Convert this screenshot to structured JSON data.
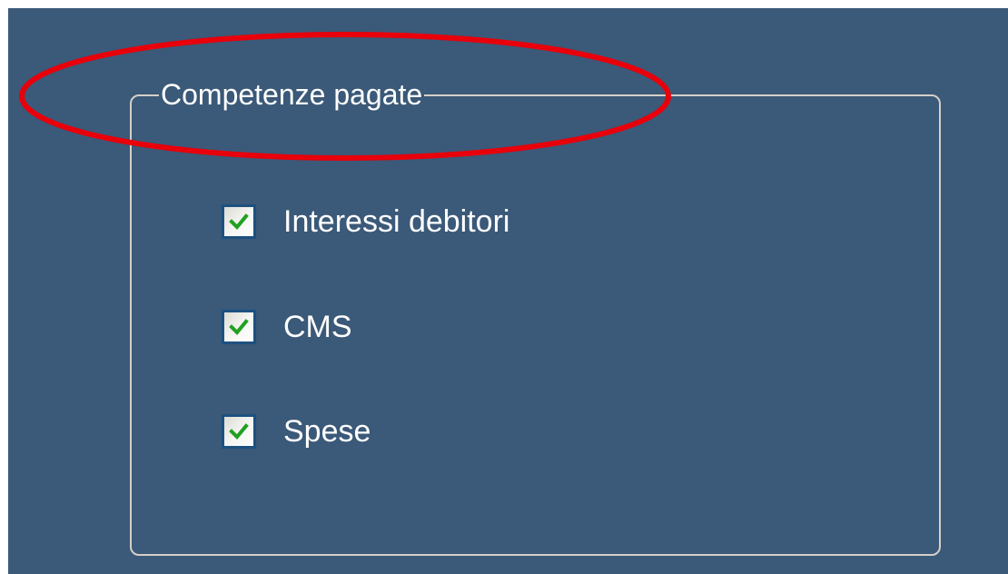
{
  "group": {
    "title": "Competenze pagate",
    "options": [
      {
        "label": "Interessi debitori",
        "checked": true
      },
      {
        "label": "CMS",
        "checked": true
      },
      {
        "label": "Spese",
        "checked": true
      }
    ]
  },
  "colors": {
    "panel_background": "#3b5978",
    "group_border": "#d4d0c8",
    "label_text": "#ffffff",
    "check_mark": "#21a121",
    "checkbox_border": "#1c5180",
    "annotation_ellipse": "#e8000b"
  },
  "icons": {
    "checkbox_mark": "check-icon"
  }
}
